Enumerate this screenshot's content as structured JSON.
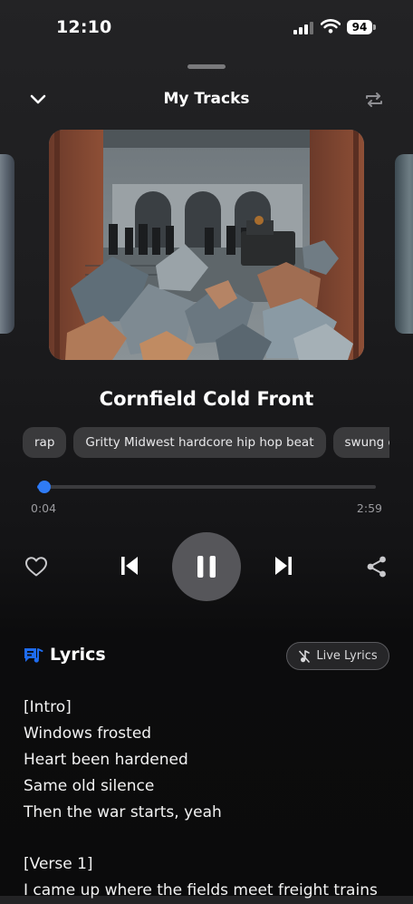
{
  "status": {
    "time": "12:10",
    "battery": "94"
  },
  "header": {
    "title": "My Tracks",
    "collapse_icon": "chevron-down-icon",
    "repeat_icon": "repeat-icon"
  },
  "song": {
    "title": "Cornfield Cold Front"
  },
  "tags": [
    "rap",
    "Gritty Midwest hardcore hip hop beat",
    "swung d"
  ],
  "player": {
    "elapsed": "0:04",
    "duration": "2:59",
    "progress_fraction": 0.022,
    "like_icon": "heart-icon",
    "prev_icon": "skip-previous-icon",
    "pause_icon": "pause-icon",
    "next_icon": "skip-next-icon",
    "share_icon": "share-icon"
  },
  "lyrics": {
    "heading": "Lyrics",
    "live_label": "Live Lyrics",
    "lines": [
      "[Intro]",
      "Windows frosted",
      "Heart been hardened",
      "Same old silence",
      "Then the war starts, yeah",
      "",
      "[Verse 1]",
      "I came up where the fields meet freight trains"
    ]
  },
  "colors": {
    "accent": "#1e6cf0",
    "background": "#1c1c1e",
    "chip": "#3a3a3c"
  }
}
